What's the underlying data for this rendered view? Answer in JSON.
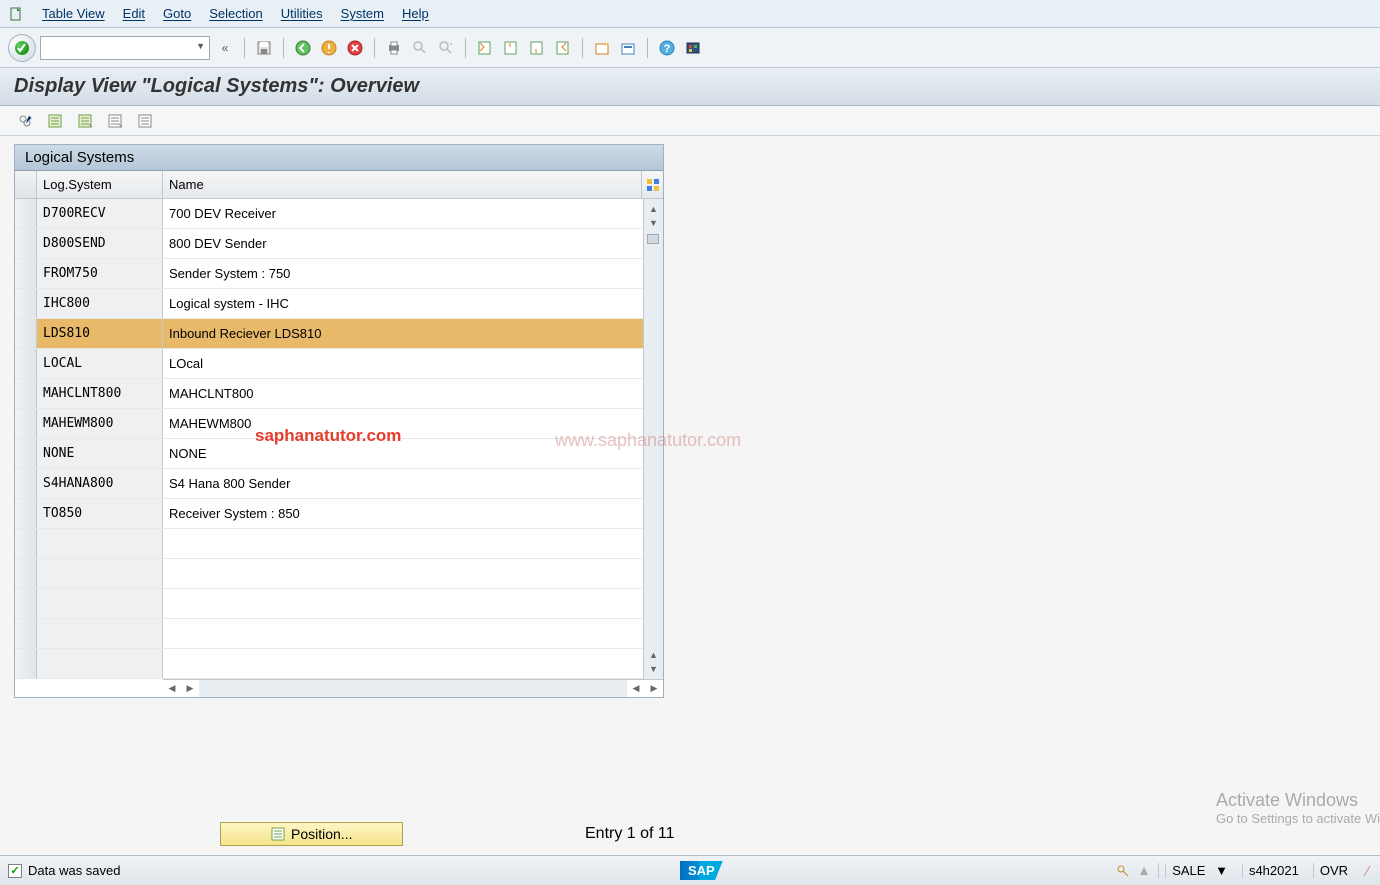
{
  "menu": {
    "items": [
      "Table View",
      "Edit",
      "Goto",
      "Selection",
      "Utilities",
      "System",
      "Help"
    ]
  },
  "title": "Display View \"Logical Systems\": Overview",
  "table": {
    "title": "Logical Systems",
    "columns": {
      "c1": "Log.System",
      "c2": "Name"
    },
    "rows": [
      {
        "ls": "D700RECV",
        "name": "700 DEV Receiver",
        "hl": false
      },
      {
        "ls": "D800SEND",
        "name": "800 DEV Sender",
        "hl": false
      },
      {
        "ls": "FROM750",
        "name": "Sender System : 750",
        "hl": false
      },
      {
        "ls": "IHC800",
        "name": "Logical system - IHC",
        "hl": false
      },
      {
        "ls": "LDS810",
        "name": "Inbound Reciever LDS810",
        "hl": true
      },
      {
        "ls": "LOCAL",
        "name": "LOcal",
        "hl": false
      },
      {
        "ls": "MAHCLNT800",
        "name": "MAHCLNT800",
        "hl": false
      },
      {
        "ls": "MAHEWM800",
        "name": "MAHEWM800",
        "hl": false
      },
      {
        "ls": "NONE",
        "name": "NONE",
        "hl": false
      },
      {
        "ls": "S4HANA800",
        "name": "S4 Hana 800 Sender",
        "hl": false
      },
      {
        "ls": "TO850",
        "name": "Receiver System : 850",
        "hl": false
      }
    ],
    "empty_rows": 5
  },
  "position_button": "Position...",
  "entry_text": "Entry 1 of 11",
  "status": {
    "message": "Data was saved",
    "tcode": "SALE",
    "system": "s4h2021",
    "mode": "OVR"
  },
  "watermarks": {
    "w1": "saphanatutor.com",
    "w2": "www.saphanatutor.com"
  },
  "activate": {
    "title": "Activate Windows",
    "sub": "Go to Settings to activate Wi"
  }
}
